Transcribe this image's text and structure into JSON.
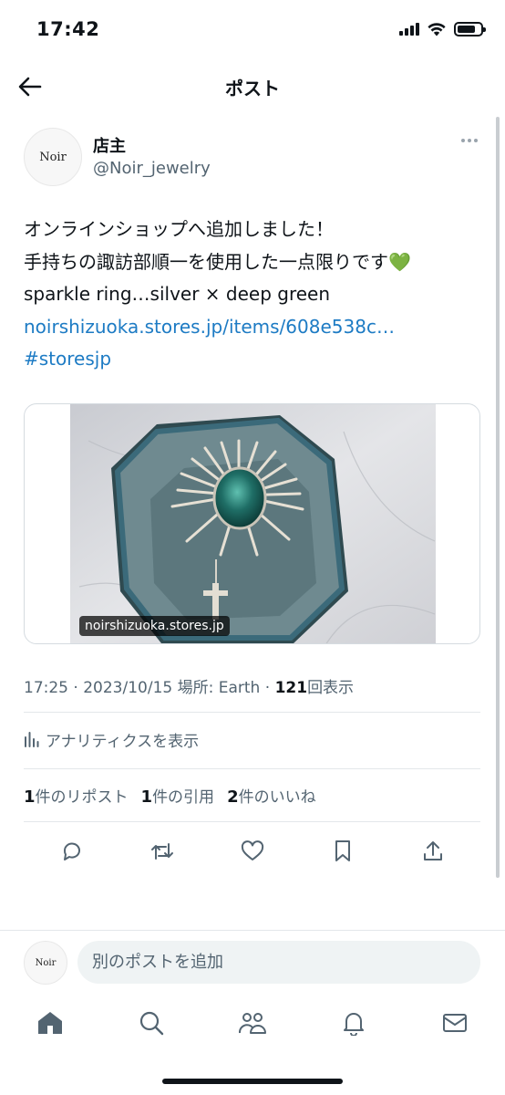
{
  "status_bar": {
    "time": "17:42",
    "icons": [
      "signal-icon",
      "wifi-icon",
      "battery-icon"
    ]
  },
  "header": {
    "back_icon": "arrow-left-icon",
    "title": "ポスト"
  },
  "post": {
    "avatar_text": "Noir",
    "author_name": "店主",
    "author_handle": "@Noir_jewelry",
    "more_icon": "more-horizontal-icon",
    "text_lines": [
      "オンラインショップへ追加しました！",
      "手持ちの諏訪部順一を使用した一点限りです",
      "sparkle ring…silver × deep green"
    ],
    "emoji": "💚",
    "link_text": "noirshizuoka.stores.jp/items/608e538c…",
    "hashtag": "#storesjp",
    "media": {
      "domain_label": "noirshizuoka.stores.jp",
      "description_colors": {
        "velvet_box": "#6f8a90",
        "marble": "#d7d8dc",
        "gem": "#1f6e66",
        "silver": "#dcd6cc"
      }
    },
    "meta": {
      "time": "17:25",
      "date": "2023/10/15",
      "location_label": "場所: Earth",
      "views_count": "121",
      "views_label": "回表示"
    },
    "analytics_label": "アナリティクスを表示",
    "stats": {
      "reposts_count": "1",
      "reposts_label": "件のリポスト",
      "quotes_count": "1",
      "quotes_label": "件の引用",
      "likes_count": "2",
      "likes_label": "件のいいね"
    },
    "actions": [
      "reply-icon",
      "repost-icon",
      "like-icon",
      "bookmark-icon",
      "share-icon"
    ]
  },
  "reply": {
    "avatar_text": "Noir",
    "placeholder": "別のポストを追加"
  },
  "bottom_nav": {
    "items": [
      "home-icon",
      "search-icon",
      "communities-icon",
      "notifications-icon",
      "messages-icon"
    ]
  },
  "colors": {
    "text_primary": "#0f1419",
    "text_secondary": "#536471",
    "link": "#1d7bc4",
    "divider": "#e3e7ea"
  }
}
